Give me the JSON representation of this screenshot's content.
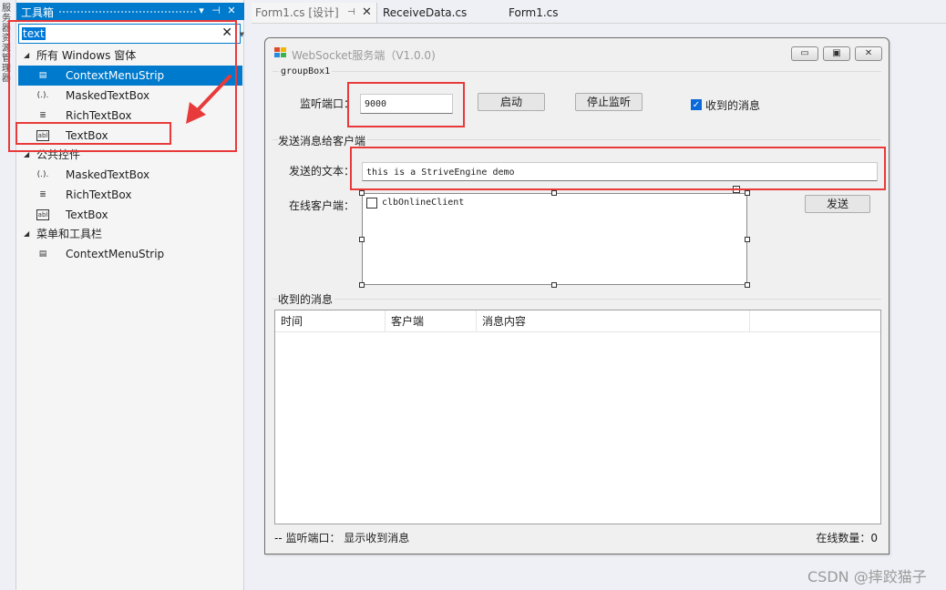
{
  "left_strip": {
    "label": "服务器资源管理器"
  },
  "toolbox": {
    "title": "工具箱",
    "buttons": [
      "▾",
      "⊣",
      "✕"
    ],
    "search": {
      "value": "text",
      "clear": "✕"
    },
    "groups": [
      {
        "label": "所有 Windows 窗体",
        "items": [
          {
            "icon": "contextmenustrip-icon",
            "glyph": "▤",
            "label": "ContextMenuStrip",
            "selected": true
          },
          {
            "icon": "maskedtextbox-icon",
            "glyph": "(.).",
            "label": "MaskedTextBox",
            "selected": false
          },
          {
            "icon": "richtextbox-icon",
            "glyph": "≣",
            "label": "RichTextBox",
            "selected": false
          },
          {
            "icon": "textbox-icon",
            "glyph": "abl",
            "label": "TextBox",
            "selected": false
          }
        ]
      },
      {
        "label": "公共控件",
        "items": [
          {
            "icon": "maskedtextbox-icon",
            "glyph": "(.).",
            "label": "MaskedTextBox",
            "selected": false
          },
          {
            "icon": "richtextbox-icon",
            "glyph": "≣",
            "label": "RichTextBox",
            "selected": false
          },
          {
            "icon": "textbox-icon",
            "glyph": "abl",
            "label": "TextBox",
            "selected": false
          }
        ]
      },
      {
        "label": "菜单和工具栏",
        "items": [
          {
            "icon": "contextmenustrip-icon",
            "glyph": "▤",
            "label": "ContextMenuStrip",
            "selected": false
          }
        ]
      }
    ]
  },
  "tabs": [
    {
      "label": "Form1.cs [设计]",
      "pin": "⊣",
      "close": "✕",
      "active": true
    },
    {
      "label": "ReceiveData.cs",
      "active": false
    },
    {
      "label": "Form1.cs",
      "active": false
    }
  ],
  "form": {
    "title": "WebSocket服务端（V1.0.0)",
    "window_buttons": {
      "minimize": "▭",
      "restore": "▣",
      "close": "✕"
    },
    "groupbox1": {
      "title": "groupBox1",
      "port_label": "监听端口：",
      "port_value": "9000",
      "start_button": "启动",
      "stop_button": "停止监听",
      "received_checkbox": {
        "label": "收到的消息",
        "checked": true
      }
    },
    "send_section": {
      "title": "发送消息给客户端",
      "text_label": "发送的文本：",
      "text_value": "this is a StriveEngine demo",
      "clients_label": "在线客户端：",
      "client_item": "clbOnlineClient",
      "send_button": "发送"
    },
    "received_section": {
      "title": "收到的消息",
      "columns": [
        "时间",
        "客户端",
        "消息内容"
      ]
    },
    "status_bar": {
      "left": "--  监听端口：  显示收到消息",
      "right": "在线数量：0"
    }
  },
  "colors": {
    "accent": "#007acc",
    "highlight": "#e83a3a"
  },
  "watermark": "CSDN @摔跤猫子"
}
